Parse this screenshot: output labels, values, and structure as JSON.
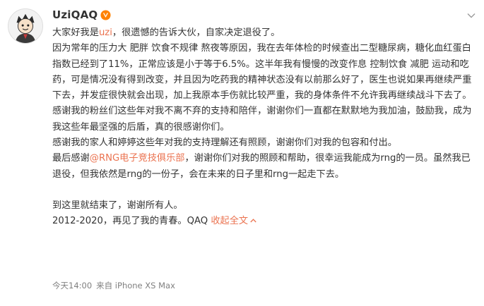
{
  "post": {
    "username": "UziQAQ",
    "verified_badge_icon": "v-verified-badge-icon",
    "line1_a": "大家好我是",
    "line1_name": "uzi",
    "line1_b": "，很遗憾的告诉大伙，自家决定退役了。",
    "para2": "因为常年的压力大 肥胖 饮食不规律 熬夜等原因，我在去年体检的时候查出二型糖尿病，糖化血红蛋白指数已经到了11%，正常应该是小于等于6.5%。这半年我有慢慢的改变作息 控制饮食 减肥 运动和吃药，可是情况没有得到改变，并且因为吃药我的精神状态没有以前那么好了，医生也说如果再继续严重下去，并发症很快就会出现，加上我原本手伤就比较严重，我的身体条件不允许我再继续战斗下去了。",
    "para3": "感谢我的粉丝们这些年对我不离不弃的支持和陪伴，谢谢你们一直都在默默地为我加油，鼓励我，成为我这些年最坚强的后盾，真的很感谢你们。",
    "para4": "感谢我的家人和婷婷这些年对我的支持理解还有照顾，谢谢你们对我的包容和付出。",
    "para5_a": "最后感谢",
    "para5_link": "@RNG电子竞技俱乐部",
    "para5_b": "，谢谢你们对我的照顾和帮助，很幸运我能成为rng的一员。虽然我已退役，但我依然是rng的一份子，会在未来的日子里和rng一起走下去。",
    "para6": "到这里就结束了，谢谢所有人。",
    "para7": "2012-2020，再见了我的青春。QAQ",
    "collapse_label": "收起全文",
    "timestamp": "今天14:00",
    "source": "来自 iPhone XS Max"
  },
  "colors": {
    "accent": "#eb7350",
    "text": "#333333",
    "meta": "#808080",
    "badge": "#ff8200"
  },
  "icons": {
    "avatar": "avatar-cartoon",
    "menu": "chevron-down-icon",
    "collapse": "caret-up-icon"
  }
}
